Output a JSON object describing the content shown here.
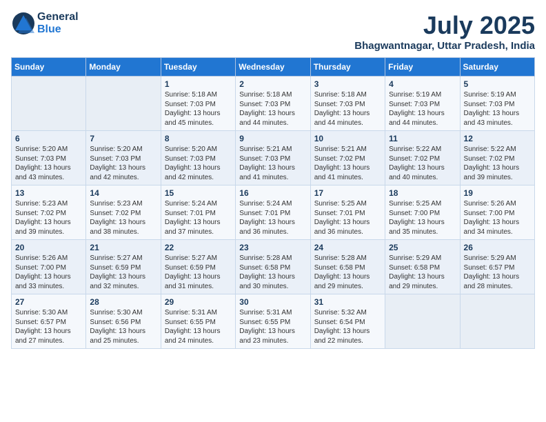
{
  "header": {
    "logo_general": "General",
    "logo_blue": "Blue",
    "month_year": "July 2025",
    "location": "Bhagwantnagar, Uttar Pradesh, India"
  },
  "weekdays": [
    "Sunday",
    "Monday",
    "Tuesday",
    "Wednesday",
    "Thursday",
    "Friday",
    "Saturday"
  ],
  "weeks": [
    [
      {
        "day": "",
        "detail": ""
      },
      {
        "day": "",
        "detail": ""
      },
      {
        "day": "1",
        "detail": "Sunrise: 5:18 AM\nSunset: 7:03 PM\nDaylight: 13 hours and 45 minutes."
      },
      {
        "day": "2",
        "detail": "Sunrise: 5:18 AM\nSunset: 7:03 PM\nDaylight: 13 hours and 44 minutes."
      },
      {
        "day": "3",
        "detail": "Sunrise: 5:18 AM\nSunset: 7:03 PM\nDaylight: 13 hours and 44 minutes."
      },
      {
        "day": "4",
        "detail": "Sunrise: 5:19 AM\nSunset: 7:03 PM\nDaylight: 13 hours and 44 minutes."
      },
      {
        "day": "5",
        "detail": "Sunrise: 5:19 AM\nSunset: 7:03 PM\nDaylight: 13 hours and 43 minutes."
      }
    ],
    [
      {
        "day": "6",
        "detail": "Sunrise: 5:20 AM\nSunset: 7:03 PM\nDaylight: 13 hours and 43 minutes."
      },
      {
        "day": "7",
        "detail": "Sunrise: 5:20 AM\nSunset: 7:03 PM\nDaylight: 13 hours and 42 minutes."
      },
      {
        "day": "8",
        "detail": "Sunrise: 5:20 AM\nSunset: 7:03 PM\nDaylight: 13 hours and 42 minutes."
      },
      {
        "day": "9",
        "detail": "Sunrise: 5:21 AM\nSunset: 7:03 PM\nDaylight: 13 hours and 41 minutes."
      },
      {
        "day": "10",
        "detail": "Sunrise: 5:21 AM\nSunset: 7:02 PM\nDaylight: 13 hours and 41 minutes."
      },
      {
        "day": "11",
        "detail": "Sunrise: 5:22 AM\nSunset: 7:02 PM\nDaylight: 13 hours and 40 minutes."
      },
      {
        "day": "12",
        "detail": "Sunrise: 5:22 AM\nSunset: 7:02 PM\nDaylight: 13 hours and 39 minutes."
      }
    ],
    [
      {
        "day": "13",
        "detail": "Sunrise: 5:23 AM\nSunset: 7:02 PM\nDaylight: 13 hours and 39 minutes."
      },
      {
        "day": "14",
        "detail": "Sunrise: 5:23 AM\nSunset: 7:02 PM\nDaylight: 13 hours and 38 minutes."
      },
      {
        "day": "15",
        "detail": "Sunrise: 5:24 AM\nSunset: 7:01 PM\nDaylight: 13 hours and 37 minutes."
      },
      {
        "day": "16",
        "detail": "Sunrise: 5:24 AM\nSunset: 7:01 PM\nDaylight: 13 hours and 36 minutes."
      },
      {
        "day": "17",
        "detail": "Sunrise: 5:25 AM\nSunset: 7:01 PM\nDaylight: 13 hours and 36 minutes."
      },
      {
        "day": "18",
        "detail": "Sunrise: 5:25 AM\nSunset: 7:00 PM\nDaylight: 13 hours and 35 minutes."
      },
      {
        "day": "19",
        "detail": "Sunrise: 5:26 AM\nSunset: 7:00 PM\nDaylight: 13 hours and 34 minutes."
      }
    ],
    [
      {
        "day": "20",
        "detail": "Sunrise: 5:26 AM\nSunset: 7:00 PM\nDaylight: 13 hours and 33 minutes."
      },
      {
        "day": "21",
        "detail": "Sunrise: 5:27 AM\nSunset: 6:59 PM\nDaylight: 13 hours and 32 minutes."
      },
      {
        "day": "22",
        "detail": "Sunrise: 5:27 AM\nSunset: 6:59 PM\nDaylight: 13 hours and 31 minutes."
      },
      {
        "day": "23",
        "detail": "Sunrise: 5:28 AM\nSunset: 6:58 PM\nDaylight: 13 hours and 30 minutes."
      },
      {
        "day": "24",
        "detail": "Sunrise: 5:28 AM\nSunset: 6:58 PM\nDaylight: 13 hours and 29 minutes."
      },
      {
        "day": "25",
        "detail": "Sunrise: 5:29 AM\nSunset: 6:58 PM\nDaylight: 13 hours and 29 minutes."
      },
      {
        "day": "26",
        "detail": "Sunrise: 5:29 AM\nSunset: 6:57 PM\nDaylight: 13 hours and 28 minutes."
      }
    ],
    [
      {
        "day": "27",
        "detail": "Sunrise: 5:30 AM\nSunset: 6:57 PM\nDaylight: 13 hours and 27 minutes."
      },
      {
        "day": "28",
        "detail": "Sunrise: 5:30 AM\nSunset: 6:56 PM\nDaylight: 13 hours and 25 minutes."
      },
      {
        "day": "29",
        "detail": "Sunrise: 5:31 AM\nSunset: 6:55 PM\nDaylight: 13 hours and 24 minutes."
      },
      {
        "day": "30",
        "detail": "Sunrise: 5:31 AM\nSunset: 6:55 PM\nDaylight: 13 hours and 23 minutes."
      },
      {
        "day": "31",
        "detail": "Sunrise: 5:32 AM\nSunset: 6:54 PM\nDaylight: 13 hours and 22 minutes."
      },
      {
        "day": "",
        "detail": ""
      },
      {
        "day": "",
        "detail": ""
      }
    ]
  ]
}
